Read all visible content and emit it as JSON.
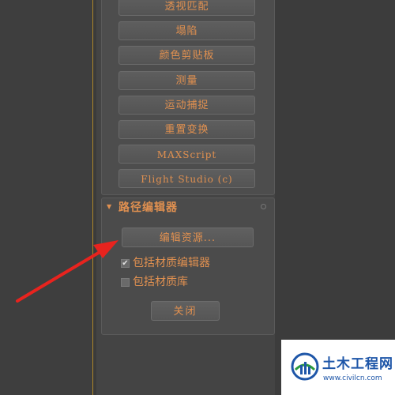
{
  "utilities": {
    "buttons": [
      {
        "label": "透视匹配"
      },
      {
        "label": "塌陷"
      },
      {
        "label": "颜色剪贴板"
      },
      {
        "label": "测量"
      },
      {
        "label": "运动捕捉"
      },
      {
        "label": "重置变换"
      },
      {
        "label": "MAXScript"
      },
      {
        "label": "Flight Studio (c)"
      }
    ]
  },
  "path_editor": {
    "title": "路径编辑器",
    "collapse_symbol": "▼",
    "browse_button": "编辑资源...",
    "checkboxes": [
      {
        "label": "包括材质编辑器",
        "checked": true,
        "mark": "✔"
      },
      {
        "label": "包括材质库",
        "checked": false,
        "mark": ""
      }
    ],
    "close_button": "关闭"
  },
  "annotation": {
    "arrow_color": "#e8231e"
  },
  "watermark": {
    "title": "土木工程网",
    "url": "www.civilcn.com"
  },
  "colors": {
    "label_orange": "#e09050",
    "panel_bg": "#444444",
    "accent_gold": "#b08a2a"
  }
}
